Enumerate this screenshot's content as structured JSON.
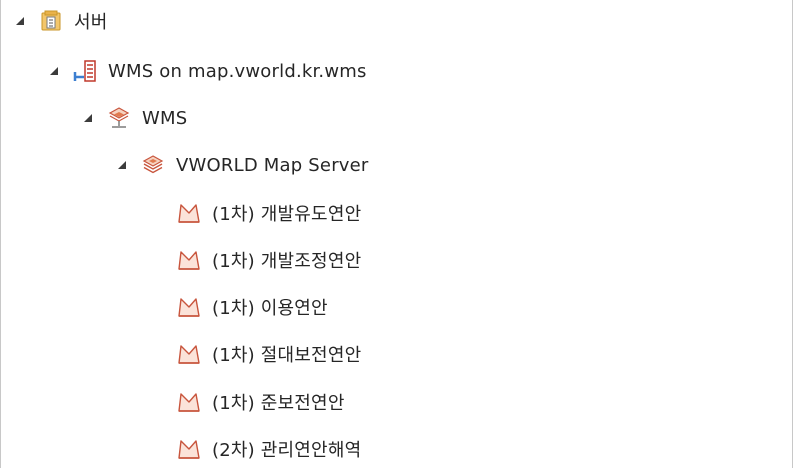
{
  "tree": {
    "server": {
      "label": "서버",
      "icon": "server-folder-icon"
    },
    "connection": {
      "label": "WMS on map.vworld.kr.wms",
      "icon": "wms-connection-icon"
    },
    "service": {
      "label": "WMS",
      "icon": "map-service-icon"
    },
    "map_server": {
      "label": "VWORLD Map Server",
      "icon": "layer-group-icon"
    },
    "layers": [
      {
        "label": "(1차) 개발유도연안",
        "icon": "polygon-layer-icon"
      },
      {
        "label": "(1차) 개발조정연안",
        "icon": "polygon-layer-icon"
      },
      {
        "label": "(1차) 이용연안",
        "icon": "polygon-layer-icon"
      },
      {
        "label": "(1차) 절대보전연안",
        "icon": "polygon-layer-icon"
      },
      {
        "label": "(1차) 준보전연안",
        "icon": "polygon-layer-icon"
      },
      {
        "label": "(2차) 관리연안해역",
        "icon": "polygon-layer-icon"
      }
    ]
  },
  "colors": {
    "arrow": "#3c3c3c",
    "folder": "#d9a43a",
    "connection_blue": "#3c7fd0",
    "connection_red": "#c0392b",
    "layer_orange": "#e07a4f",
    "polygon_red": "#c8553d"
  }
}
